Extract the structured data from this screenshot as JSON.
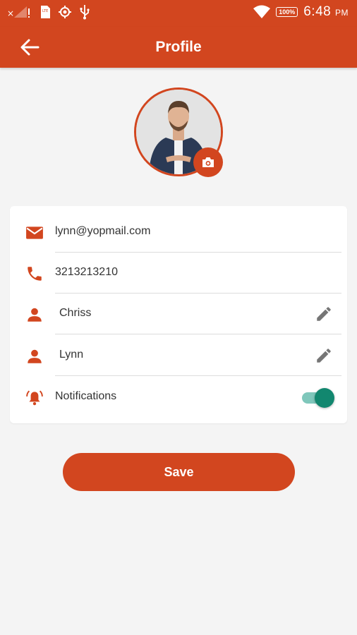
{
  "status_bar": {
    "time": "6:48",
    "ampm": "PM",
    "battery": "100%",
    "icons": [
      "signal-off-icon",
      "sim-icon",
      "gps-icon",
      "usb-icon",
      "wifi-icon",
      "battery-icon"
    ]
  },
  "app_bar": {
    "title": "Profile",
    "back_icon": "arrow-back-icon"
  },
  "profile": {
    "camera_icon": "camera-icon",
    "fields": [
      {
        "icon": "email-icon",
        "value": "lynn@yopmail.com",
        "editable": false
      },
      {
        "icon": "phone-icon",
        "value": "3213213210",
        "editable": false
      },
      {
        "icon": "person-icon",
        "value": "Chriss",
        "editable": true
      },
      {
        "icon": "person-icon",
        "value": "Lynn",
        "editable": true
      }
    ],
    "notifications": {
      "label": "Notifications",
      "enabled": true
    }
  },
  "actions": {
    "save_label": "Save"
  },
  "colors": {
    "primary": "#d2461f",
    "toggle_on": "#12876f",
    "toggle_track": "#7fc7bb",
    "background": "#f4f4f4"
  }
}
